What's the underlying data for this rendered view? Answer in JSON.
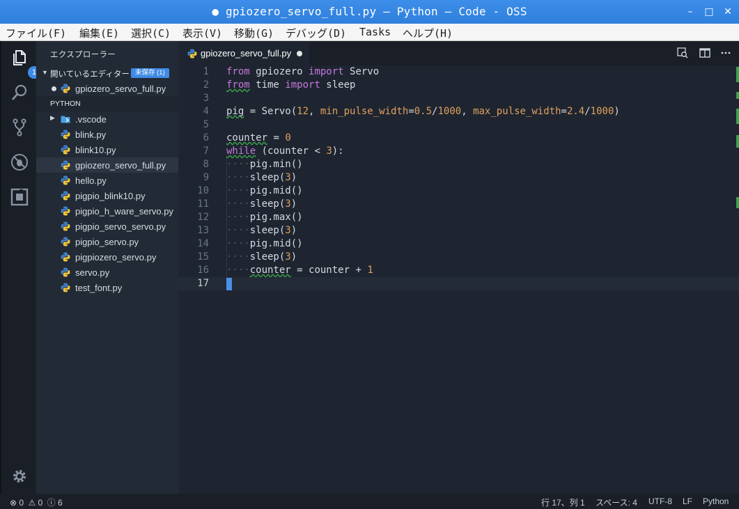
{
  "window": {
    "title": "gpiozero_servo_full.py — Python — Code - OSS",
    "modified_indicator": "●"
  },
  "menu": [
    "ファイル(F)",
    "編集(E)",
    "選択(C)",
    "表示(V)",
    "移動(G)",
    "デバッグ(D)",
    "Tasks",
    "ヘルプ(H)"
  ],
  "activity": {
    "explorer_badge": "1"
  },
  "sidebar": {
    "title": "エクスプローラー",
    "open_editors": {
      "label": "開いているエディター",
      "badge": "未保存 (1)",
      "files": [
        "gpiozero_servo_full.py"
      ]
    },
    "folder": {
      "label": "PYTHON",
      "items": [
        {
          "name": ".vscode",
          "type": "folder"
        },
        {
          "name": "blink.py",
          "type": "file"
        },
        {
          "name": "blink10.py",
          "type": "file"
        },
        {
          "name": "gpiozero_servo_full.py",
          "type": "file",
          "selected": true
        },
        {
          "name": "hello.py",
          "type": "file"
        },
        {
          "name": "pigpio_blink10.py",
          "type": "file"
        },
        {
          "name": "pigpio_h_ware_servo.py",
          "type": "file"
        },
        {
          "name": "pigpio_servo_servo.py",
          "type": "file"
        },
        {
          "name": "pigpio_servo.py",
          "type": "file"
        },
        {
          "name": "pigpiozero_servo.py",
          "type": "file"
        },
        {
          "name": "servo.py",
          "type": "file"
        },
        {
          "name": "test_font.py",
          "type": "file"
        }
      ]
    }
  },
  "editor": {
    "tab_label": "gpiozero_servo_full.py",
    "current_line": 17,
    "lines": [
      "from gpiozero import Servo",
      "from time import sleep",
      "",
      "pig = Servo(12, min_pulse_width=0.5/1000, max_pulse_width=2.4/1000)",
      "",
      "counter = 0",
      "while (counter < 3):",
      "    pig.min()",
      "    sleep(3)",
      "    pig.mid()",
      "    sleep(3)",
      "    pig.max()",
      "    sleep(3)",
      "    pig.mid()",
      "    sleep(3)",
      "    counter = counter + 1",
      ""
    ]
  },
  "status": {
    "errors": "0",
    "warnings": "0",
    "infos": "6",
    "position": "行 17、列 1",
    "spaces": "スペース: 4",
    "encoding": "UTF-8",
    "eol": "LF",
    "language": "Python"
  },
  "colors": {
    "accent": "#3f8be6",
    "keyword": "#c678dd",
    "number": "#e0a060",
    "lint_warning": "#3da34c"
  }
}
